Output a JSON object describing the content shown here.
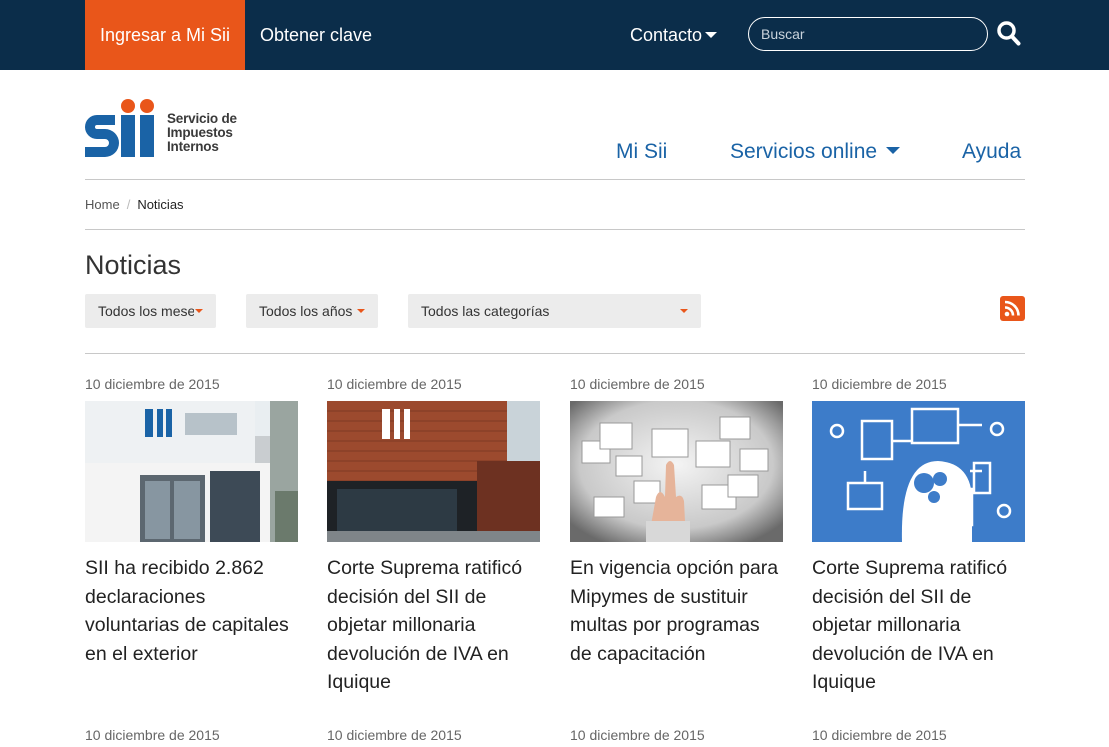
{
  "topbar": {
    "login": "Ingresar a Mi Sii",
    "get_key": "Obtener clave",
    "contact": "Contacto",
    "search_placeholder": "Buscar"
  },
  "logo": {
    "line1": "Servicio de",
    "line2": "Impuestos",
    "line3": "Internos"
  },
  "nav": {
    "mi_sii": "Mi Sii",
    "services": "Servicios online",
    "help": "Ayuda"
  },
  "breadcrumb": {
    "home": "Home",
    "current": "Noticias"
  },
  "page_title": "Noticias",
  "filters": {
    "months": "Todos los meses",
    "years": "Todos los años",
    "categories": "Todos las categorías"
  },
  "news": [
    {
      "date": "10 diciembre de 2015",
      "title": "SII ha recibido 2.862 declaraciones voluntarias de capitales en el exterior"
    },
    {
      "date": "10 diciembre de 2015",
      "title": "Corte Suprema ratificó decisión del SII de objetar millonaria devolución de IVA en Iquique"
    },
    {
      "date": "10 diciembre de 2015",
      "title": "En vigencia opción para Mipymes de sustituir multas por programas de capacitación"
    },
    {
      "date": "10 diciembre de 2015",
      "title": "Corte Suprema ratificó decisión del SII de objetar millonaria devolución de IVA en Iquique"
    }
  ],
  "news_row2_dates": [
    "10 diciembre de 2015",
    "10 diciembre de 2015",
    "10 diciembre de 2015",
    "10 diciembre de 2015"
  ],
  "colors": {
    "topbar": "#0b2d4a",
    "accent": "#e9561a",
    "link": "#1a63a6"
  }
}
